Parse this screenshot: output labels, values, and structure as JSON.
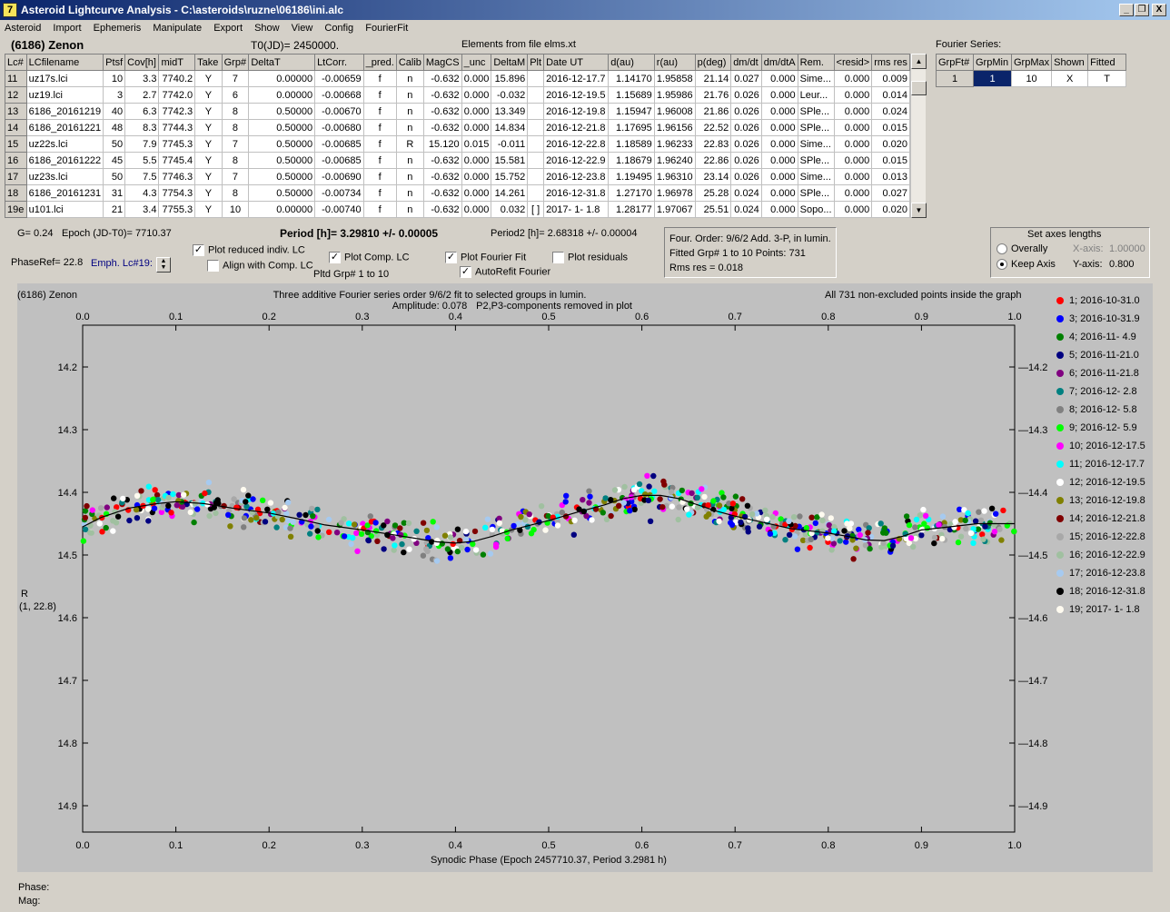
{
  "window": {
    "title": "Asteroid Lightcurve Analysis - C:\\asteroids\\ruzne\\06186\\ini.alc",
    "app_icon_glyph": "7",
    "min_glyph": "_",
    "restore_glyph": "❐",
    "close_glyph": "X"
  },
  "menu": [
    "Asteroid",
    "Import",
    "Ephemeris",
    "Manipulate",
    "Export",
    "Show",
    "View",
    "Config",
    "FourierFit"
  ],
  "header": {
    "asteroid": "(6186) Zenon",
    "t0": "T0(JD)= 2450000.",
    "elements": "Elements from file elms.xt"
  },
  "table": {
    "columns": [
      "Lc#",
      "LCfilename",
      "Ptsf",
      "Cov[h]",
      "midT",
      "Take",
      "Grp#",
      "DeltaT",
      "LtCorr.",
      "_pred.",
      "Calib",
      "MagCS",
      "_unc",
      "DeltaM",
      "Plt",
      "Date UT",
      "d(au)",
      "r(au)",
      "p(deg)",
      "dm/dt",
      "dm/dtA",
      "Rem.",
      "<resid>",
      "rms res"
    ],
    "rows": [
      [
        "11",
        "uz17s.lci",
        "10",
        "3.3",
        "7740.2",
        "Y",
        "7",
        "0.00000",
        "-0.00659",
        "f",
        "n",
        "-0.632",
        "0.000",
        "15.896",
        "",
        "2016-12-17.7",
        "1.14170",
        "1.95858",
        "21.14",
        "0.027",
        "0.000",
        "Sime...",
        "0.000",
        "0.009"
      ],
      [
        "12",
        "uz19.lci",
        "3",
        "2.7",
        "7742.0",
        "Y",
        "6",
        "0.00000",
        "-0.00668",
        "f",
        "n",
        "-0.632",
        "0.000",
        "-0.032",
        "",
        "2016-12-19.5",
        "1.15689",
        "1.95986",
        "21.76",
        "0.026",
        "0.000",
        "Leur...",
        "0.000",
        "0.014"
      ],
      [
        "13",
        "6186_20161219",
        "40",
        "6.3",
        "7742.3",
        "Y",
        "8",
        "0.50000",
        "-0.00670",
        "f",
        "n",
        "-0.632",
        "0.000",
        "13.349",
        "",
        "2016-12-19.8",
        "1.15947",
        "1.96008",
        "21.86",
        "0.026",
        "0.000",
        "SPle...",
        "0.000",
        "0.024"
      ],
      [
        "14",
        "6186_20161221",
        "48",
        "8.3",
        "7744.3",
        "Y",
        "8",
        "0.50000",
        "-0.00680",
        "f",
        "n",
        "-0.632",
        "0.000",
        "14.834",
        "",
        "2016-12-21.8",
        "1.17695",
        "1.96156",
        "22.52",
        "0.026",
        "0.000",
        "SPle...",
        "0.000",
        "0.015"
      ],
      [
        "15",
        "uz22s.lci",
        "50",
        "7.9",
        "7745.3",
        "Y",
        "7",
        "0.50000",
        "-0.00685",
        "f",
        "R",
        "15.120",
        "0.015",
        "-0.011",
        "",
        "2016-12-22.8",
        "1.18589",
        "1.96233",
        "22.83",
        "0.026",
        "0.000",
        "Sime...",
        "0.000",
        "0.020"
      ],
      [
        "16",
        "6186_20161222",
        "45",
        "5.5",
        "7745.4",
        "Y",
        "8",
        "0.50000",
        "-0.00685",
        "f",
        "n",
        "-0.632",
        "0.000",
        "15.581",
        "",
        "2016-12-22.9",
        "1.18679",
        "1.96240",
        "22.86",
        "0.026",
        "0.000",
        "SPle...",
        "0.000",
        "0.015"
      ],
      [
        "17",
        "uz23s.lci",
        "50",
        "7.5",
        "7746.3",
        "Y",
        "7",
        "0.50000",
        "-0.00690",
        "f",
        "n",
        "-0.632",
        "0.000",
        "15.752",
        "",
        "2016-12-23.8",
        "1.19495",
        "1.96310",
        "23.14",
        "0.026",
        "0.000",
        "Sime...",
        "0.000",
        "0.013"
      ],
      [
        "18",
        "6186_20161231",
        "31",
        "4.3",
        "7754.3",
        "Y",
        "8",
        "0.50000",
        "-0.00734",
        "f",
        "n",
        "-0.632",
        "0.000",
        "14.261",
        "",
        "2016-12-31.8",
        "1.27170",
        "1.96978",
        "25.28",
        "0.024",
        "0.000",
        "SPle...",
        "0.000",
        "0.027"
      ],
      [
        "19e",
        "u101.lci",
        "21",
        "3.4",
        "7755.3",
        "Y",
        "10",
        "0.00000",
        "-0.00740",
        "f",
        "n",
        "-0.632",
        "0.000",
        "0.032",
        "[ ]",
        "2017- 1- 1.8",
        "1.28177",
        "1.97067",
        "25.51",
        "0.024",
        "0.000",
        "Sopo...",
        "0.000",
        "0.020"
      ]
    ]
  },
  "fourier_series": {
    "label": "Fourier Series:",
    "columns": [
      "GrpFt#",
      "GrpMin",
      "GrpMax",
      "Shown",
      "Fitted"
    ],
    "row": [
      "1",
      "1",
      "10",
      "X",
      "T"
    ]
  },
  "info": {
    "g": "G= 0.24",
    "epoch": "Epoch (JD-T0)= 7710.37",
    "period": "Period [h]= 3.29810 +/- 0.00005",
    "period2": "Period2 [h]= 2.68318 +/- 0.00004",
    "phaseref": "PhaseRef= 22.8",
    "emph": "Emph. Lc#19:",
    "plot_reduced": "Plot reduced indiv. LC",
    "align": "Align with Comp. LC",
    "plot_comp": "Plot Comp. LC",
    "pltd_grp": "Pltd Grp#  1   to   10",
    "plot_fourier": "Plot Fourier Fit",
    "autorefit": "AutoRefit Fourier",
    "plot_residuals": "Plot residuals",
    "four_order": "Four. Order:  9/6/2   Add. 3-P, in lumin.",
    "fitted_grp": "Fitted Grp# 1 to 10   Points: 731",
    "rms_res": "Rms res     = 0.018",
    "check": "✓"
  },
  "axes_settings": {
    "title": "Set axes lengths",
    "overally": "Overally",
    "keep_axis": "Keep Axis",
    "x_axis_label": "X-axis:",
    "x_axis_value": "1.00000",
    "y_axis_label": "Y-axis:",
    "y_axis_value": "0.800"
  },
  "chart_data": {
    "type": "scatter",
    "title": "Three additive Fourier series order 9/6/2 fit to selected groups in lumin.",
    "subtitle": "Amplitude: 0.078",
    "note": "P2,P3-components removed in plot",
    "left_label": "(6186) Zenon",
    "right_label": "All 731 non-excluded points inside the graph",
    "xlabel": "Synodic Phase (Epoch 2457710.37, Period 3.2981 h)",
    "ylabel": "R",
    "ylabel2": "(1, 22.8)",
    "xlim": [
      0.0,
      1.0
    ],
    "ylim": [
      14.2,
      14.9
    ],
    "y_inverted": true,
    "x_ticks": [
      "0.0",
      "0.1",
      "0.2",
      "0.3",
      "0.4",
      "0.5",
      "0.6",
      "0.7",
      "0.8",
      "0.9",
      "1.0"
    ],
    "y_ticks": [
      "14.2",
      "14.3",
      "14.4",
      "14.5",
      "14.6",
      "14.7",
      "14.8",
      "14.9"
    ],
    "fit_curve": {
      "x": [
        0.0,
        0.02,
        0.05,
        0.08,
        0.1,
        0.13,
        0.16,
        0.2,
        0.23,
        0.26,
        0.3,
        0.33,
        0.36,
        0.38,
        0.4,
        0.42,
        0.44,
        0.46,
        0.5,
        0.53,
        0.56,
        0.58,
        0.6,
        0.62,
        0.64,
        0.66,
        0.68,
        0.7,
        0.73,
        0.76,
        0.8,
        0.82,
        0.84,
        0.86,
        0.88,
        0.9,
        0.93,
        0.96,
        1.0
      ],
      "y": [
        14.455,
        14.44,
        14.425,
        14.418,
        14.415,
        14.418,
        14.425,
        14.433,
        14.442,
        14.452,
        14.46,
        14.467,
        14.474,
        14.479,
        14.481,
        14.478,
        14.47,
        14.46,
        14.445,
        14.432,
        14.42,
        14.41,
        14.405,
        14.405,
        14.41,
        14.42,
        14.43,
        14.438,
        14.448,
        14.458,
        14.465,
        14.47,
        14.476,
        14.477,
        14.47,
        14.46,
        14.455,
        14.45,
        14.45
      ]
    },
    "series": [
      {
        "name": "1; 2016-10-31.0",
        "color": "#ff0000"
      },
      {
        "name": "3; 2016-10-31.9",
        "color": "#0000ff"
      },
      {
        "name": "4; 2016-11- 4.9",
        "color": "#008000"
      },
      {
        "name": "5; 2016-11-21.0",
        "color": "#000080"
      },
      {
        "name": "6; 2016-11-21.8",
        "color": "#800080"
      },
      {
        "name": "7; 2016-12- 2.8",
        "color": "#008080"
      },
      {
        "name": "8; 2016-12- 5.8",
        "color": "#808080"
      },
      {
        "name": "9; 2016-12- 5.9",
        "color": "#00ff00"
      },
      {
        "name": "10; 2016-12-17.5",
        "color": "#ff00ff"
      },
      {
        "name": "11; 2016-12-17.7",
        "color": "#00ffff"
      },
      {
        "name": "12; 2016-12-19.5",
        "color": "#ffffff"
      },
      {
        "name": "13; 2016-12-19.8",
        "color": "#808000"
      },
      {
        "name": "14; 2016-12-21.8",
        "color": "#800000"
      },
      {
        "name": "15; 2016-12-22.8",
        "color": "#a8a8a8"
      },
      {
        "name": "16; 2016-12-22.9",
        "color": "#a0c0a0"
      },
      {
        "name": "17; 2016-12-23.8",
        "color": "#a6caf0"
      },
      {
        "name": "18; 2016-12-31.8",
        "color": "#000000"
      },
      {
        "name": "19; 2017- 1- 1.8",
        "color": "#fffbf0"
      }
    ],
    "scatter": "estimated ~730 points scattered around fit curve with spread ~0.02 mag"
  },
  "status": {
    "phase_label": "Phase:",
    "mag_label": "Mag:"
  }
}
